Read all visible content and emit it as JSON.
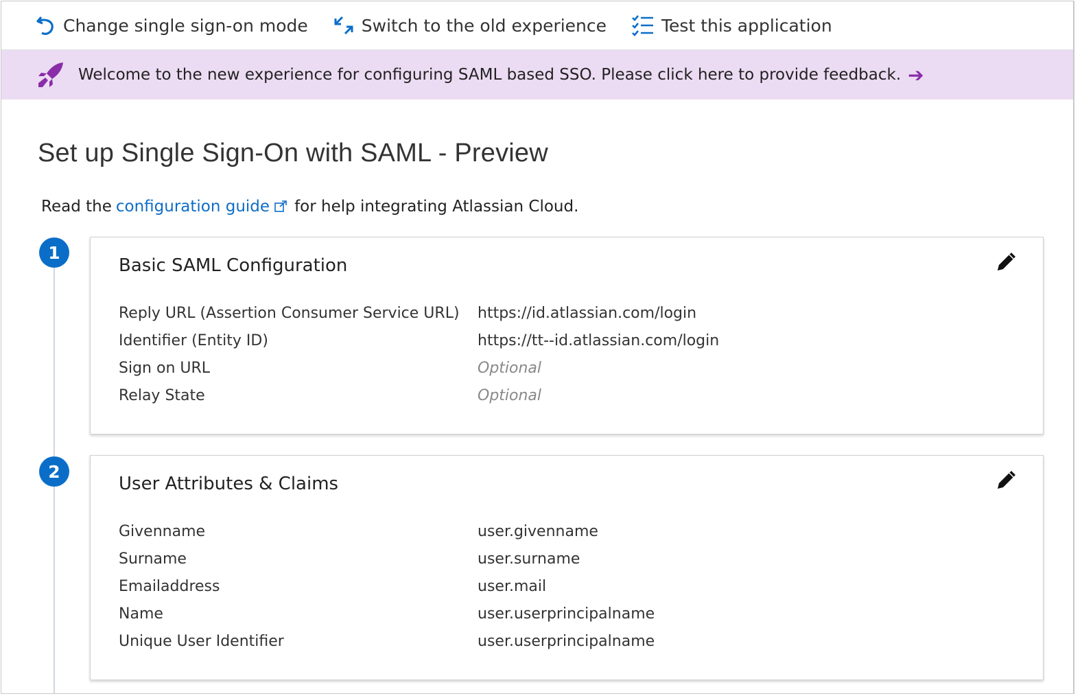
{
  "toolbar": {
    "change_mode": "Change single sign-on mode",
    "switch_old": "Switch to the old experience",
    "test_app": "Test this application"
  },
  "banner": {
    "text": "Welcome to the new experience for configuring SAML based SSO. Please click here to provide feedback.",
    "arrow": "➔"
  },
  "page": {
    "title": "Set up Single Sign-On with SAML - Preview",
    "guide_prefix": "Read the",
    "guide_link": "configuration guide",
    "guide_suffix": "for help integrating Atlassian Cloud."
  },
  "sections": [
    {
      "num": "1",
      "title": "Basic SAML Configuration",
      "rows": [
        {
          "k": "Reply URL (Assertion Consumer Service URL)",
          "v": "https://id.atlassian.com/login"
        },
        {
          "k": "Identifier (Entity ID)",
          "v": "https://tt--id.atlassian.com/login"
        },
        {
          "k": "Sign on URL",
          "v": "Optional"
        },
        {
          "k": "Relay State",
          "v": "Optional"
        }
      ]
    },
    {
      "num": "2",
      "title": "User Attributes & Claims",
      "rows": [
        {
          "k": "Givenname",
          "v": "user.givenname"
        },
        {
          "k": "Surname",
          "v": "user.surname"
        },
        {
          "k": "Emailaddress",
          "v": "user.mail"
        },
        {
          "k": "Name",
          "v": "user.userprincipalname"
        },
        {
          "k": "Unique User Identifier",
          "v": "user.userprincipalname"
        }
      ]
    }
  ],
  "colors": {
    "accent_blue": "#0a6ec8",
    "banner_bg": "#ecdcf3",
    "rocket_purple": "#8a2da8"
  }
}
